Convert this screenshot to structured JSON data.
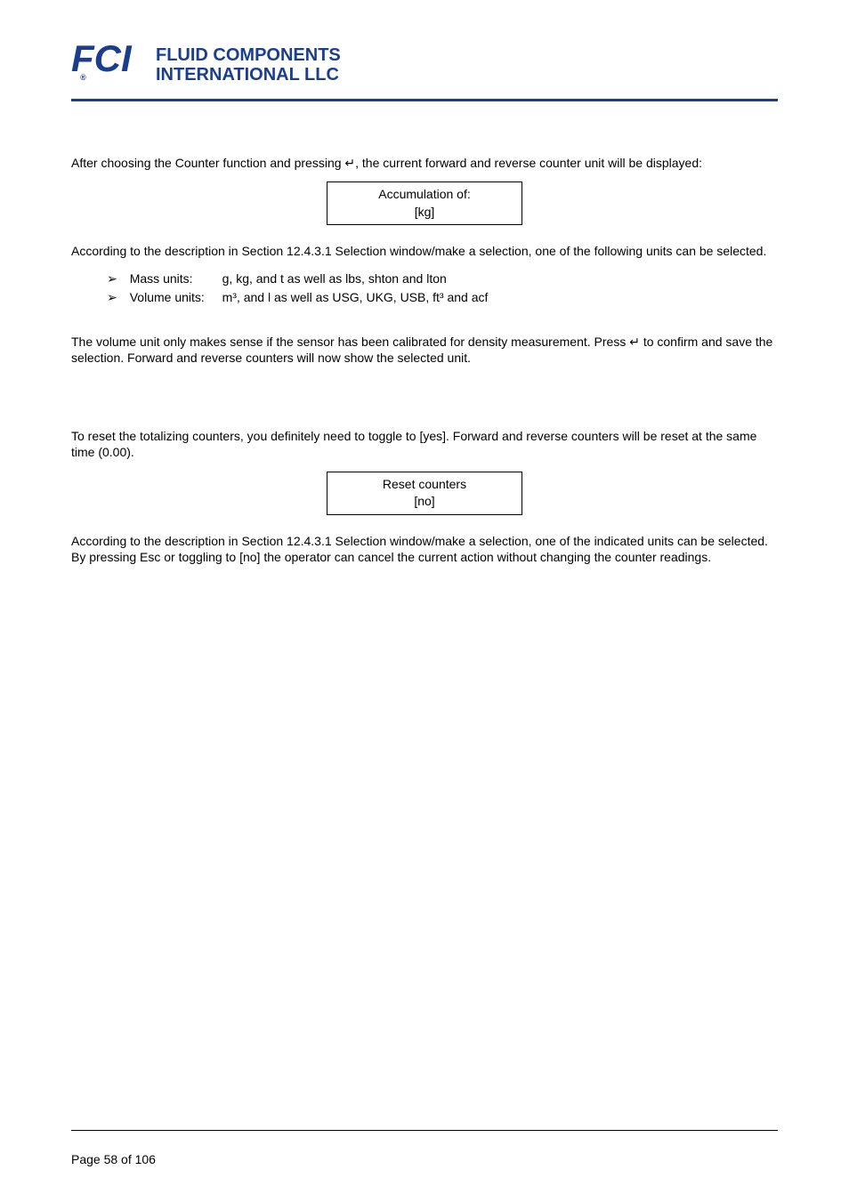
{
  "logo": {
    "line1": "FLUID COMPONENTS",
    "line2": "INTERNATIONAL LLC"
  },
  "para1": "After choosing the Counter function and pressing ↵, the current forward and reverse counter unit will be displayed:",
  "displayBox1": {
    "line1": "Accumulation of:",
    "line2": "[kg]"
  },
  "para2": "According to the description in Section 12.4.3.1 Selection window/make a selection, one of the following units can be selected.",
  "bullets": [
    {
      "label": "Mass units:",
      "text": "g, kg, and t as well as lbs, shton and lton"
    },
    {
      "label": "Volume units:",
      "text": "m³, and l as well as USG, UKG, USB, ft³ and acf"
    }
  ],
  "para3": "The volume unit only makes sense if the sensor has been calibrated for density measurement. Press ↵ to confirm and save the selection. Forward and reverse counters will now show the selected unit.",
  "para4": "To reset the totalizing counters, you definitely need to toggle to [yes]. Forward and reverse counters will be reset at the same time (0.00).",
  "displayBox2": {
    "line1": "Reset counters",
    "line2": "[no]"
  },
  "para5": "According to the description in Section 12.4.3.1 Selection window/make a selection, one of the indicated units can be selected. By pressing Esc or toggling to [no] the operator can cancel the current action without changing the counter readings.",
  "pageNumber": "Page 58 of 106"
}
